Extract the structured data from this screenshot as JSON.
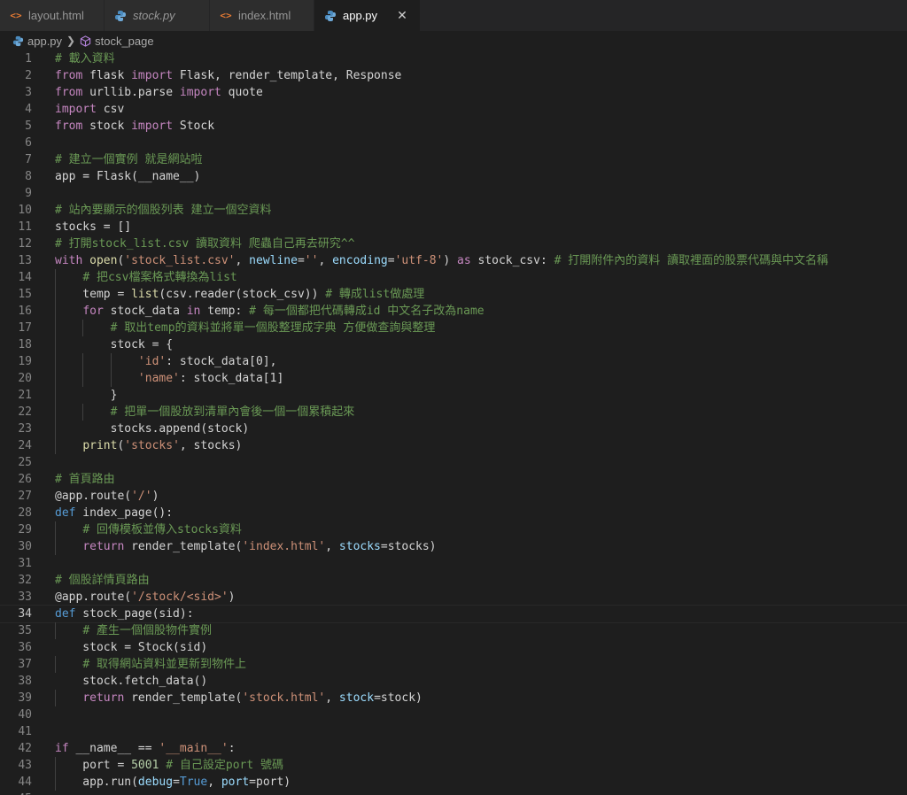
{
  "tabs": [
    {
      "label": "layout.html",
      "icon": "html-file-icon"
    },
    {
      "label": "stock.py",
      "icon": "python-file-icon"
    },
    {
      "label": "index.html",
      "icon": "html-file-icon"
    },
    {
      "label": "app.py",
      "icon": "python-file-icon",
      "close": "✕"
    }
  ],
  "breadcrumb": {
    "file": "app.py",
    "symbol": "stock_page"
  },
  "colors": {
    "comment": "#6a9955",
    "string": "#ce9178",
    "keyword": "#c586c0",
    "function": "#dcdcaa",
    "variable": "#9cdcfe",
    "number": "#b5cea8",
    "class": "#4ec9b0",
    "background": "#1e1e1e"
  },
  "current_line": 34,
  "lines": [
    {
      "n": "1",
      "t": [
        [
          "# 載入資料",
          "c"
        ]
      ]
    },
    {
      "n": "2",
      "t": [
        [
          "from",
          "kc"
        ],
        [
          " flask ",
          ""
        ],
        [
          "import",
          "kc"
        ],
        [
          " Flask, render_template, Response",
          ""
        ]
      ]
    },
    {
      "n": "3",
      "t": [
        [
          "from",
          "kc"
        ],
        [
          " urllib.parse ",
          ""
        ],
        [
          "import",
          "kc"
        ],
        [
          " quote",
          ""
        ]
      ]
    },
    {
      "n": "4",
      "t": [
        [
          "import",
          "kc"
        ],
        [
          " csv",
          ""
        ]
      ]
    },
    {
      "n": "5",
      "t": [
        [
          "from",
          "kc"
        ],
        [
          " stock ",
          ""
        ],
        [
          "import",
          "kc"
        ],
        [
          " Stock",
          ""
        ]
      ]
    },
    {
      "n": "6",
      "t": []
    },
    {
      "n": "7",
      "t": [
        [
          "# 建立一個實例 就是網站啦",
          "c"
        ]
      ]
    },
    {
      "n": "8",
      "t": [
        [
          "app = Flask(__name__)",
          ""
        ]
      ]
    },
    {
      "n": "9",
      "t": []
    },
    {
      "n": "10",
      "t": [
        [
          "# 站內要顯示的個股列表 建立一個空資料",
          "c"
        ]
      ]
    },
    {
      "n": "11",
      "t": [
        [
          "stocks = []",
          ""
        ]
      ]
    },
    {
      "n": "12",
      "t": [
        [
          "# 打開stock_list.csv 讀取資料 爬蟲自己再去研究^^",
          "c"
        ]
      ]
    },
    {
      "n": "13",
      "t": [
        [
          "with",
          "kc"
        ],
        [
          " ",
          ""
        ],
        [
          "open",
          "f"
        ],
        [
          "(",
          ""
        ],
        [
          "'stock_list.csv'",
          "s"
        ],
        [
          ", ",
          ""
        ],
        [
          "newline",
          "v"
        ],
        [
          "=",
          ""
        ],
        [
          "''",
          "s"
        ],
        [
          ", ",
          ""
        ],
        [
          "encoding",
          "v"
        ],
        [
          "=",
          ""
        ],
        [
          "'utf-8'",
          "s"
        ],
        [
          ") ",
          ""
        ],
        [
          "as",
          "kc"
        ],
        [
          " stock_csv: ",
          ""
        ],
        [
          "# 打開附件內的資料 讀取裡面的股票代碼與中文名稱",
          "c"
        ]
      ]
    },
    {
      "n": "14",
      "t": [
        [
          "    ",
          ""
        ],
        [
          "# 把csv檔案格式轉換為list",
          "c"
        ]
      ]
    },
    {
      "n": "15",
      "t": [
        [
          "    temp = ",
          ""
        ],
        [
          "list",
          "f"
        ],
        [
          "(csv.reader(stock_csv)) ",
          ""
        ],
        [
          "# 轉成list做處理",
          "c"
        ]
      ]
    },
    {
      "n": "16",
      "t": [
        [
          "    ",
          ""
        ],
        [
          "for",
          "kc"
        ],
        [
          " stock_data ",
          ""
        ],
        [
          "in",
          "kc"
        ],
        [
          " temp: ",
          ""
        ],
        [
          "# 每一個都把代碼轉成id 中文名子改為name",
          "c"
        ]
      ]
    },
    {
      "n": "17",
      "t": [
        [
          "        ",
          ""
        ],
        [
          "# 取出temp的資料並將單一個股整理成字典 方便做查詢與整理",
          "c"
        ]
      ]
    },
    {
      "n": "18",
      "t": [
        [
          "        stock = {",
          ""
        ]
      ]
    },
    {
      "n": "19",
      "t": [
        [
          "            ",
          ""
        ],
        [
          "'id'",
          "s"
        ],
        [
          ": stock_data[0],",
          ""
        ]
      ]
    },
    {
      "n": "20",
      "t": [
        [
          "            ",
          ""
        ],
        [
          "'name'",
          "s"
        ],
        [
          ": stock_data[1]",
          ""
        ]
      ]
    },
    {
      "n": "21",
      "t": [
        [
          "        }",
          ""
        ]
      ]
    },
    {
      "n": "22",
      "t": [
        [
          "        ",
          ""
        ],
        [
          "# 把單一個股放到清單內會後一個一個累積起來",
          "c"
        ]
      ]
    },
    {
      "n": "23",
      "t": [
        [
          "        stocks.append(stock)",
          ""
        ]
      ]
    },
    {
      "n": "24",
      "t": [
        [
          "    ",
          ""
        ],
        [
          "print",
          "f"
        ],
        [
          "(",
          ""
        ],
        [
          "'stocks'",
          "s"
        ],
        [
          ", stocks)",
          ""
        ]
      ]
    },
    {
      "n": "25",
      "t": []
    },
    {
      "n": "26",
      "t": [
        [
          "# 首頁路由",
          "c"
        ]
      ]
    },
    {
      "n": "27",
      "t": [
        [
          "@app.route(",
          ""
        ],
        [
          "'/'",
          "s"
        ],
        [
          ")",
          ""
        ]
      ]
    },
    {
      "n": "28",
      "t": [
        [
          "def",
          "k"
        ],
        [
          " index_page():",
          ""
        ]
      ]
    },
    {
      "n": "29",
      "t": [
        [
          "    ",
          ""
        ],
        [
          "# 回傳模板並傳入stocks資料",
          "c"
        ]
      ]
    },
    {
      "n": "30",
      "t": [
        [
          "    ",
          ""
        ],
        [
          "return",
          "kc"
        ],
        [
          " render_template(",
          ""
        ],
        [
          "'index.html'",
          "s"
        ],
        [
          ", ",
          ""
        ],
        [
          "stocks",
          "v"
        ],
        [
          "=stocks)",
          ""
        ]
      ]
    },
    {
      "n": "31",
      "t": []
    },
    {
      "n": "32",
      "t": [
        [
          "# 個股詳情頁路由",
          "c"
        ]
      ]
    },
    {
      "n": "33",
      "t": [
        [
          "@app.route(",
          ""
        ],
        [
          "'/stock/<sid>'",
          "s"
        ],
        [
          ")",
          ""
        ]
      ]
    },
    {
      "n": "34",
      "t": [
        [
          "def",
          "k"
        ],
        [
          " stock_page(sid):",
          ""
        ]
      ]
    },
    {
      "n": "35",
      "t": [
        [
          "    ",
          ""
        ],
        [
          "# 產生一個個股物件實例",
          "c"
        ]
      ]
    },
    {
      "n": "36",
      "t": [
        [
          "    stock = Stock(sid)",
          ""
        ]
      ]
    },
    {
      "n": "37",
      "t": [
        [
          "    ",
          ""
        ],
        [
          "# 取得網站資料並更新到物件上",
          "c"
        ]
      ]
    },
    {
      "n": "38",
      "t": [
        [
          "    stock.fetch_data()",
          ""
        ]
      ]
    },
    {
      "n": "39",
      "t": [
        [
          "    ",
          ""
        ],
        [
          "return",
          "kc"
        ],
        [
          " render_template(",
          ""
        ],
        [
          "'stock.html'",
          "s"
        ],
        [
          ", ",
          ""
        ],
        [
          "stock",
          "v"
        ],
        [
          "=stock)",
          ""
        ]
      ]
    },
    {
      "n": "40",
      "t": []
    },
    {
      "n": "41",
      "t": []
    },
    {
      "n": "42",
      "t": [
        [
          "if",
          "kc"
        ],
        [
          " __name__ == ",
          ""
        ],
        [
          "'__main__'",
          "s"
        ],
        [
          ":",
          ""
        ]
      ]
    },
    {
      "n": "43",
      "t": [
        [
          "    port = ",
          ""
        ],
        [
          "5001",
          "n"
        ],
        [
          " ",
          ""
        ],
        [
          "# 自己設定port 號碼",
          "c"
        ]
      ]
    },
    {
      "n": "44",
      "t": [
        [
          "    app.run(",
          ""
        ],
        [
          "debug",
          "v"
        ],
        [
          "=",
          ""
        ],
        [
          "True",
          "k"
        ],
        [
          ", ",
          ""
        ],
        [
          "port",
          "v"
        ],
        [
          "=port)",
          ""
        ]
      ]
    },
    {
      "n": "45",
      "t": []
    }
  ]
}
